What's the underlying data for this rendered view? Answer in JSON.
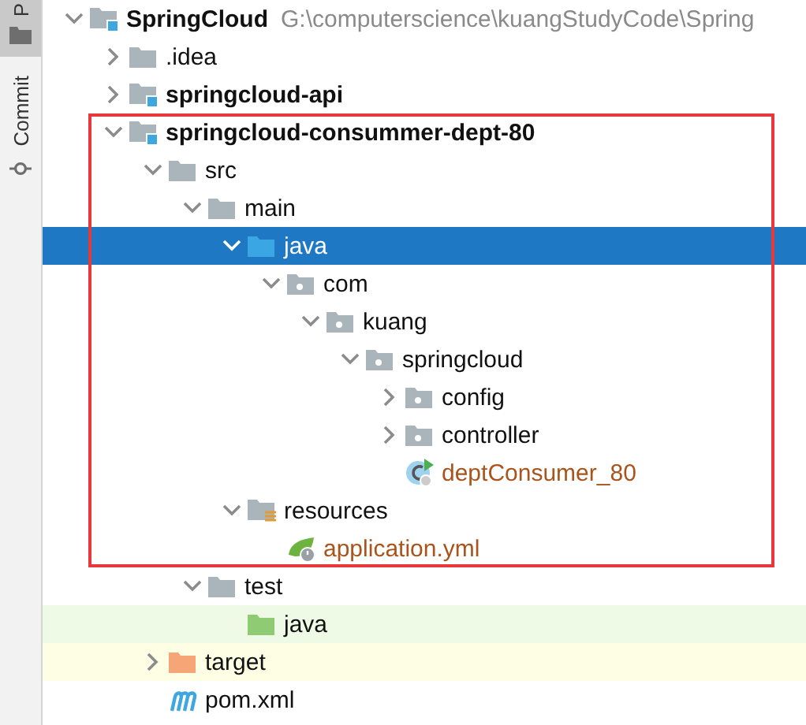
{
  "tool_strip": [
    {
      "label": "P",
      "selected": true
    },
    {
      "label": "Commit",
      "selected": false
    }
  ],
  "tree": [
    {
      "label": "SpringCloud",
      "hint": "G:\\computerscience\\kuangStudyCode\\Spring",
      "kind": "module",
      "expanded": true,
      "selected": false,
      "highlighted": false,
      "unversioned": false,
      "children": [
        {
          "label": ".idea",
          "kind": "folder",
          "expanded": false,
          "selected": false,
          "highlighted": false,
          "unversioned": false
        },
        {
          "label": "springcloud-api",
          "kind": "module",
          "expanded": false,
          "selected": false,
          "highlighted": false,
          "unversioned": false
        },
        {
          "label": "springcloud-consummer-dept-80",
          "kind": "module",
          "expanded": true,
          "selected": false,
          "highlighted": true,
          "unversioned": false,
          "children": [
            {
              "label": "src",
              "kind": "folder",
              "expanded": true,
              "selected": false,
              "highlighted": true,
              "unversioned": false,
              "children": [
                {
                  "label": "main",
                  "kind": "folder",
                  "expanded": true,
                  "selected": false,
                  "highlighted": true,
                  "unversioned": false,
                  "children": [
                    {
                      "label": "java",
                      "kind": "source_root",
                      "expanded": true,
                      "selected": true,
                      "highlighted": true,
                      "unversioned": false,
                      "children": [
                        {
                          "label": "com",
                          "kind": "package",
                          "expanded": true,
                          "selected": false,
                          "highlighted": true,
                          "unversioned": false,
                          "children": [
                            {
                              "label": "kuang",
                              "kind": "package",
                              "expanded": true,
                              "selected": false,
                              "highlighted": true,
                              "unversioned": false,
                              "children": [
                                {
                                  "label": "springcloud",
                                  "kind": "package",
                                  "expanded": true,
                                  "selected": false,
                                  "highlighted": true,
                                  "unversioned": false,
                                  "children": [
                                    {
                                      "label": "config",
                                      "kind": "package",
                                      "expanded": false,
                                      "selected": false,
                                      "highlighted": true,
                                      "unversioned": false
                                    },
                                    {
                                      "label": "controller",
                                      "kind": "package",
                                      "expanded": false,
                                      "selected": false,
                                      "highlighted": true,
                                      "unversioned": false
                                    },
                                    {
                                      "label": "deptConsumer_80",
                                      "kind": "spring_class",
                                      "selected": false,
                                      "highlighted": true,
                                      "unversioned": true
                                    }
                                  ]
                                }
                              ]
                            }
                          ]
                        }
                      ]
                    },
                    {
                      "label": "resources",
                      "kind": "resources_root",
                      "expanded": true,
                      "selected": false,
                      "highlighted": true,
                      "unversioned": false,
                      "children": [
                        {
                          "label": "application.yml",
                          "kind": "spring_config",
                          "selected": false,
                          "highlighted": true,
                          "unversioned": true
                        }
                      ]
                    }
                  ]
                },
                {
                  "label": "test",
                  "kind": "folder",
                  "expanded": true,
                  "selected": false,
                  "highlighted": false,
                  "unversioned": false,
                  "children": [
                    {
                      "label": "java",
                      "kind": "test_root",
                      "selected": false,
                      "highlighted": false,
                      "unversioned": false
                    }
                  ]
                }
              ]
            },
            {
              "label": "target",
              "kind": "excluded",
              "expanded": false,
              "selected": false,
              "highlighted": false,
              "unversioned": false
            },
            {
              "label": "pom.xml",
              "kind": "maven",
              "selected": false,
              "highlighted": false,
              "unversioned": false
            }
          ]
        }
      ]
    }
  ]
}
